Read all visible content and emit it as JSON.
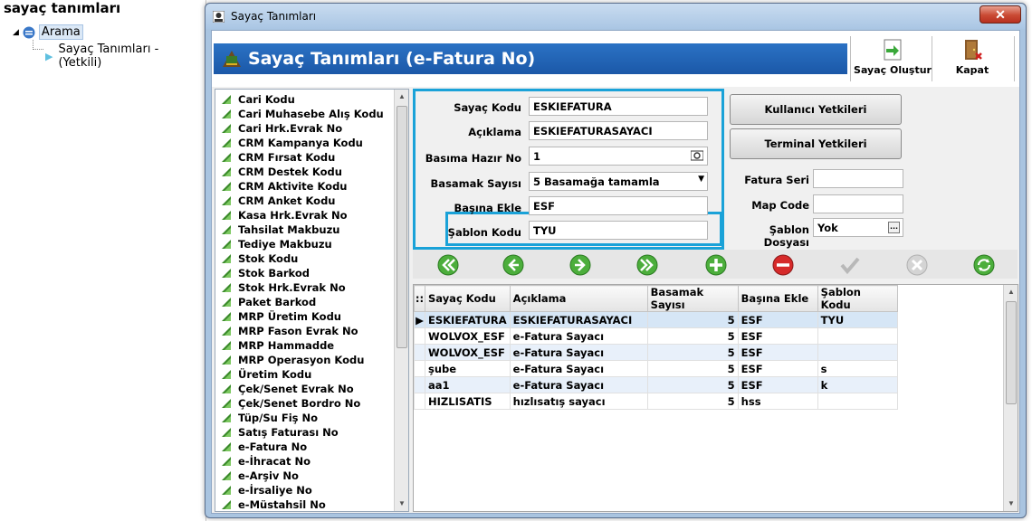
{
  "background": {
    "title": "sayaç tanımları",
    "tree_root": "Arama",
    "tree_child": "Sayaç Tanımları - (Yetkili)"
  },
  "window": {
    "title": "Sayaç Tanımları",
    "close_glyph": "✕"
  },
  "header": {
    "title": "Sayaç Tanımları (e-Fatura No)",
    "buttons": {
      "create": "Sayaç Oluştur",
      "close": "Kapat"
    }
  },
  "sidebar": {
    "items": [
      "Cari Kodu",
      "Cari Muhasebe Alış Kodu",
      "Cari Hrk.Evrak No",
      "CRM Kampanya Kodu",
      "CRM Fırsat Kodu",
      "CRM Destek Kodu",
      "CRM Aktivite Kodu",
      "CRM Anket Kodu",
      "Kasa Hrk.Evrak No",
      "Tahsilat Makbuzu",
      "Tediye Makbuzu",
      "Stok Kodu",
      "Stok Barkod",
      "Stok Hrk.Evrak No",
      "Paket Barkod",
      "MRP Üretim Kodu",
      "MRP Fason Evrak No",
      "MRP Hammadde",
      "MRP Operasyon Kodu",
      "Üretim Kodu",
      "Çek/Senet Evrak No",
      "Çek/Senet Bordro No",
      "Tüp/Su Fiş No",
      "Satış Faturası No",
      "e-Fatura No",
      "e-İhracat No",
      "e-Arşiv No",
      "e-İrsaliye No",
      "e-Müstahsil No"
    ]
  },
  "form": {
    "labels": {
      "sayac_kodu": "Sayaç Kodu",
      "aciklama": "Açıklama",
      "basima_hazir_no": "Basıma Hazır No",
      "basamak_sayisi": "Basamak Sayısı",
      "basina_ekle": "Başına Ekle",
      "sablon_kodu": "Şablon Kodu",
      "fatura_seri": "Fatura Seri",
      "map_code": "Map Code",
      "sablon_dosyasi": "Şablon Dosyası"
    },
    "values": {
      "sayac_kodu": "ESKIEFATURA",
      "aciklama": "ESKIEFATURASAYACI",
      "basima_hazir_no": "1",
      "basamak_sayisi": "5 Basamağa tamamla",
      "basina_ekle": "ESF",
      "sablon_kodu": "TYU",
      "fatura_seri": "",
      "map_code": "",
      "sablon_dosyasi": "Yok"
    },
    "ellipsis": "..."
  },
  "actions": {
    "kullanici_yetkileri": "Kullanıcı Yetkileri",
    "terminal_yetkileri": "Terminal Yetkileri"
  },
  "grid": {
    "columns": [
      "Sayaç Kodu",
      "Açıklama",
      "Basamak Sayısı",
      "Başına Ekle",
      "Şablon Kodu"
    ],
    "rows": [
      {
        "kod": "ESKIEFATURA",
        "aciklama": "ESKIEFATURASAYACI",
        "basamak": "5",
        "ek": "ESF",
        "sablon": "TYU"
      },
      {
        "kod": "WOLVOX_ESF",
        "aciklama": "e-Fatura Sayacı",
        "basamak": "5",
        "ek": "ESF",
        "sablon": ""
      },
      {
        "kod": "WOLVOX_ESF",
        "aciklama": "e-Fatura Sayacı",
        "basamak": "5",
        "ek": "ESF",
        "sablon": ""
      },
      {
        "kod": "şube",
        "aciklama": "e-Fatura Sayacı",
        "basamak": "5",
        "ek": "ESF",
        "sablon": "s"
      },
      {
        "kod": "aa1",
        "aciklama": "e-Fatura Sayacı",
        "basamak": "5",
        "ek": "ESF",
        "sablon": "k"
      },
      {
        "kod": "HIZLISATIS",
        "aciklama": "hızlısatış sayacı",
        "basamak": "5",
        "ek": "hss",
        "sablon": ""
      }
    ]
  },
  "colors": {
    "title_blue": "#1b58a8",
    "highlight": "#1aa2d8",
    "list_icon_green": "#3a8a2a"
  }
}
